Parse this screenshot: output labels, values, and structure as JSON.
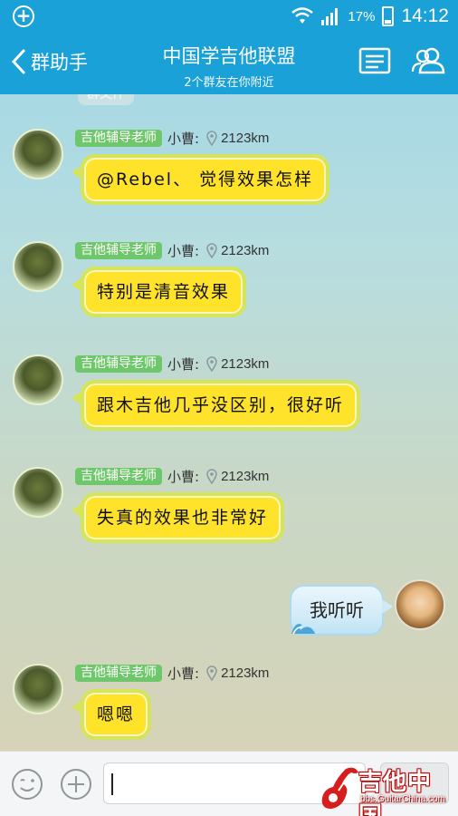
{
  "status_bar": {
    "battery": "17%",
    "time": "14:12"
  },
  "header": {
    "back_label": "群助手",
    "title": "中国学吉他联盟",
    "subtitle": "2个群友在你附近"
  },
  "chat": {
    "partial_tag": "群文件",
    "messages": [
      {
        "tag": "吉他辅导老师",
        "sender": "小曹:",
        "distance": "2123km",
        "text": "@Rebel、 觉得效果怎样"
      },
      {
        "tag": "吉他辅导老师",
        "sender": "小曹:",
        "distance": "2123km",
        "text": "特别是清音效果"
      },
      {
        "tag": "吉他辅导老师",
        "sender": "小曹:",
        "distance": "2123km",
        "text": "跟木吉他几乎没区别，很好听"
      },
      {
        "tag": "吉他辅导老师",
        "sender": "小曹:",
        "distance": "2123km",
        "text": "失真的效果也非常好"
      },
      {
        "tag": "吉他辅导老师",
        "sender": "小曹:",
        "distance": "2123km",
        "text": "嗯嗯"
      }
    ],
    "my_message": {
      "text": "我听听"
    }
  },
  "watermark": {
    "title": "吉他中国",
    "url": "bbs.GuitarChina.com"
  },
  "colors": {
    "primary": "#1aa1d8",
    "bubble": "#ffe22a",
    "tag": "#6ec76a"
  }
}
